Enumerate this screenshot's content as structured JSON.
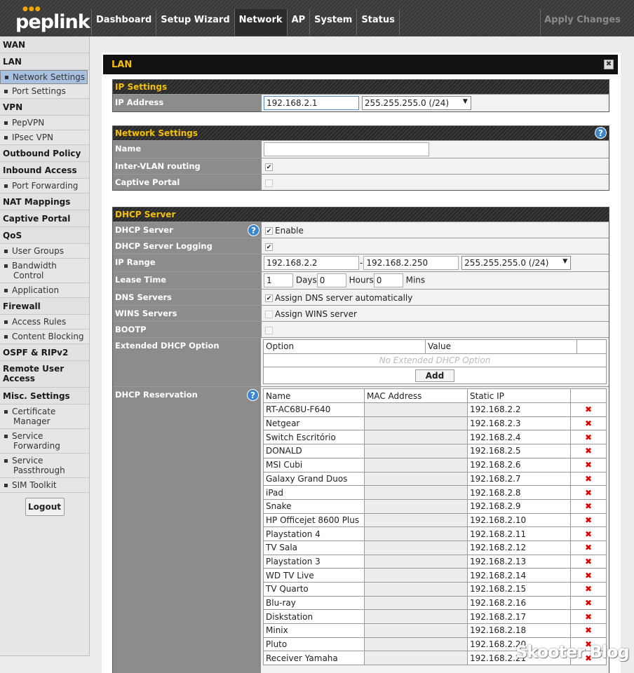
{
  "brand": {
    "logo_text": "peplink",
    "logo_dots": "●●●"
  },
  "nav": {
    "tabs": [
      "Dashboard",
      "Setup Wizard",
      "Network",
      "AP",
      "System",
      "Status"
    ],
    "active": "Network",
    "apply": "Apply Changes"
  },
  "sidebar": [
    {
      "label": "WAN",
      "type": "header"
    },
    {
      "label": "LAN",
      "type": "header"
    },
    {
      "label": "Network Settings",
      "type": "item",
      "selected": true
    },
    {
      "label": "Port Settings",
      "type": "item"
    },
    {
      "label": "VPN",
      "type": "header"
    },
    {
      "label": "PepVPN",
      "type": "item"
    },
    {
      "label": "IPsec VPN",
      "type": "item"
    },
    {
      "label": "Outbound Policy",
      "type": "header"
    },
    {
      "label": "Inbound Access",
      "type": "header"
    },
    {
      "label": "Port Forwarding",
      "type": "item"
    },
    {
      "label": "NAT Mappings",
      "type": "header"
    },
    {
      "label": "Captive Portal",
      "type": "header"
    },
    {
      "label": "QoS",
      "type": "header"
    },
    {
      "label": "User Groups",
      "type": "item"
    },
    {
      "label": "Bandwidth Control",
      "type": "item2"
    },
    {
      "label": "Application",
      "type": "item"
    },
    {
      "label": "Firewall",
      "type": "header"
    },
    {
      "label": "Access Rules",
      "type": "item"
    },
    {
      "label": "Content Blocking",
      "type": "item"
    },
    {
      "label": "OSPF & RIPv2",
      "type": "header"
    },
    {
      "label": "Remote User Access",
      "type": "header2"
    },
    {
      "label": "Misc. Settings",
      "type": "header"
    },
    {
      "label": "Certificate Manager",
      "type": "item2"
    },
    {
      "label": "Service Forwarding",
      "type": "item2"
    },
    {
      "label": "Service Passthrough",
      "type": "item2"
    },
    {
      "label": "SIM Toolkit",
      "type": "item"
    }
  ],
  "logout": "Logout",
  "panel": {
    "title": "LAN",
    "close": "✖"
  },
  "ip_settings": {
    "title": "IP Settings",
    "ip_label": "IP Address",
    "ip_value": "192.168.2.1",
    "mask": "255.255.255.0 (/24)"
  },
  "network_settings": {
    "title": "Network Settings",
    "name_label": "Name",
    "name_value": "",
    "intervlan_label": "Inter-VLAN routing",
    "captive_label": "Captive Portal"
  },
  "dhcp": {
    "title": "DHCP Server",
    "server_label": "DHCP Server",
    "enable": "Enable",
    "logging_label": "DHCP Server Logging",
    "range_label": "IP Range",
    "range_start": "192.168.2.2",
    "range_dash": "-",
    "range_end": "192.168.2.250",
    "range_mask": "255.255.255.0 (/24)",
    "lease_label": "Lease Time",
    "lease_days": "1",
    "days": "Days",
    "lease_hours": "0",
    "hours": "Hours",
    "lease_mins": "0",
    "mins": "Mins",
    "dns_label": "DNS Servers",
    "dns_auto": "Assign DNS server automatically",
    "wins_label": "WINS Servers",
    "wins_assign": "Assign WINS server",
    "bootp_label": "BOOTP",
    "ext_label": "Extended DHCP Option",
    "ext_col_option": "Option",
    "ext_col_value": "Value",
    "ext_empty": "No Extended DHCP Option",
    "ext_add": "Add",
    "res_label": "DHCP Reservation",
    "res_col_name": "Name",
    "res_col_mac": "MAC Address",
    "res_col_ip": "Static IP",
    "reservations": [
      {
        "name": "RT-AC68U-F640",
        "ip": "192.168.2.2"
      },
      {
        "name": "Netgear",
        "ip": "192.168.2.3"
      },
      {
        "name": "Switch Escritório",
        "ip": "192.168.2.4"
      },
      {
        "name": "DONALD",
        "ip": "192.168.2.5"
      },
      {
        "name": "MSI Cubi",
        "ip": "192.168.2.6"
      },
      {
        "name": "Galaxy Grand Duos",
        "ip": "192.168.2.7"
      },
      {
        "name": "iPad",
        "ip": "192.168.2.8"
      },
      {
        "name": "Snake",
        "ip": "192.168.2.9"
      },
      {
        "name": "HP Officejet 8600 Plus",
        "ip": "192.168.2.10"
      },
      {
        "name": "Playstation 4",
        "ip": "192.168.2.11"
      },
      {
        "name": "TV Sala",
        "ip": "192.168.2.12"
      },
      {
        "name": "Playstation 3",
        "ip": "192.168.2.13"
      },
      {
        "name": "WD TV Live",
        "ip": "192.168.2.14"
      },
      {
        "name": "TV Quarto",
        "ip": "192.168.2.15"
      },
      {
        "name": "Blu-ray",
        "ip": "192.168.2.16"
      },
      {
        "name": "Diskstation",
        "ip": "192.168.2.17"
      },
      {
        "name": "Minix",
        "ip": "192.168.2.18"
      },
      {
        "name": "Pluto",
        "ip": "192.168.2.20"
      },
      {
        "name": "Receiver Yamaha",
        "ip": "192.168.2.21"
      }
    ]
  },
  "watermark": "Skooter Blog"
}
